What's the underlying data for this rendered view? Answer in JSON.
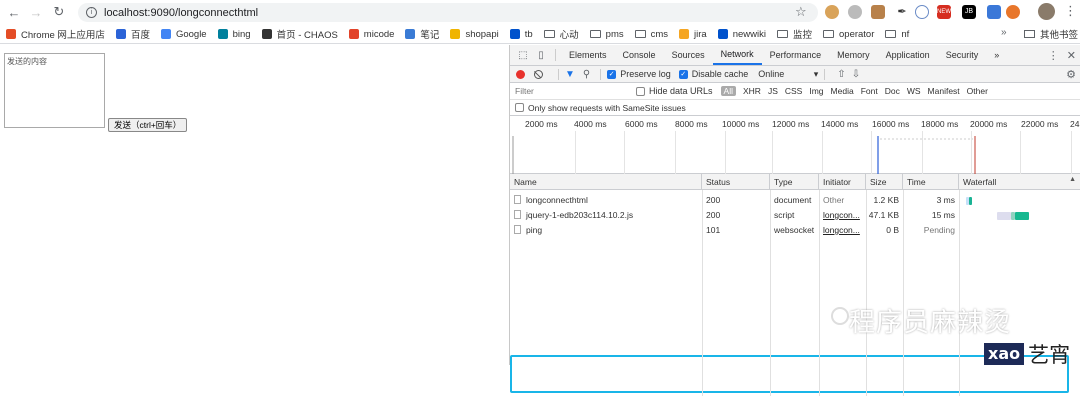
{
  "browser": {
    "url": "localhost:9090/longconnecthtml"
  },
  "bookmarks": {
    "items": [
      {
        "label": "Chrome 网上应用店",
        "color": "#e44d26"
      },
      {
        "label": "百度",
        "color": "#2b63d7"
      },
      {
        "label": "Google",
        "color": "#4285f4"
      },
      {
        "label": "bing",
        "color": "#00809d"
      },
      {
        "label": "首页 - CHAOS",
        "color": "#333333"
      },
      {
        "label": "micode",
        "color": "#e24329"
      },
      {
        "label": "笔记",
        "color": "#3a7bd5"
      },
      {
        "label": "shopapi",
        "color": "#f0b400"
      },
      {
        "label": "tb",
        "color": "#0052cc"
      },
      {
        "label": "心动",
        "folder": true
      },
      {
        "label": "pms",
        "folder": true
      },
      {
        "label": "cms",
        "folder": true
      },
      {
        "label": "jira",
        "color": "#f5a623"
      },
      {
        "label": "newwiki",
        "color": "#0052cc"
      },
      {
        "label": "监控",
        "folder": true
      },
      {
        "label": "operator",
        "folder": true
      },
      {
        "label": "nf",
        "folder": true
      }
    ],
    "more": "»",
    "other": "其他书签"
  },
  "page": {
    "textarea_placeholder": "发送的内容",
    "send_button": "发送（ctrl+回车）"
  },
  "devtools": {
    "tabs": [
      "Elements",
      "Console",
      "Sources",
      "Network",
      "Performance",
      "Memory",
      "Application",
      "Security"
    ],
    "active_tab": "Network",
    "overflow": "»",
    "toolbar": {
      "preserve_log": "Preserve log",
      "disable_cache": "Disable cache",
      "throttling": "Online"
    },
    "filter": {
      "placeholder": "Filter",
      "hide_data_urls": "Hide data URLs",
      "types": [
        "All",
        "XHR",
        "JS",
        "CSS",
        "Img",
        "Media",
        "Font",
        "Doc",
        "WS",
        "Manifest",
        "Other"
      ],
      "samesite": "Only show requests with SameSite issues"
    },
    "timeline_ticks": [
      "2000 ms",
      "4000 ms",
      "6000 ms",
      "8000 ms",
      "10000 ms",
      "12000 ms",
      "14000 ms",
      "16000 ms",
      "18000 ms",
      "20000 ms",
      "22000 ms",
      "24"
    ],
    "columns": [
      "Name",
      "Status",
      "Type",
      "Initiator",
      "Size",
      "Time",
      "Waterfall"
    ],
    "rows": [
      {
        "name": "longconnecthtml",
        "status": "200",
        "type": "document",
        "initiator": "Other",
        "size": "1.2 KB",
        "time": "3 ms"
      },
      {
        "name": "jquery-1-edb203c114.10.2.js",
        "status": "200",
        "type": "script",
        "initiator": "longcon...",
        "size": "47.1 KB",
        "time": "15 ms"
      },
      {
        "name": "ping",
        "status": "101",
        "type": "websocket",
        "initiator": "longcon...",
        "size": "0 B",
        "time": "Pending"
      }
    ]
  },
  "watermark": {
    "text": "程序员麻辣烫",
    "brand_box": "xao",
    "brand_text": "艺宵"
  },
  "colors": {
    "accent": "#1a73e8",
    "highlight_border": "#19b5e8",
    "record": "#e8322d"
  }
}
